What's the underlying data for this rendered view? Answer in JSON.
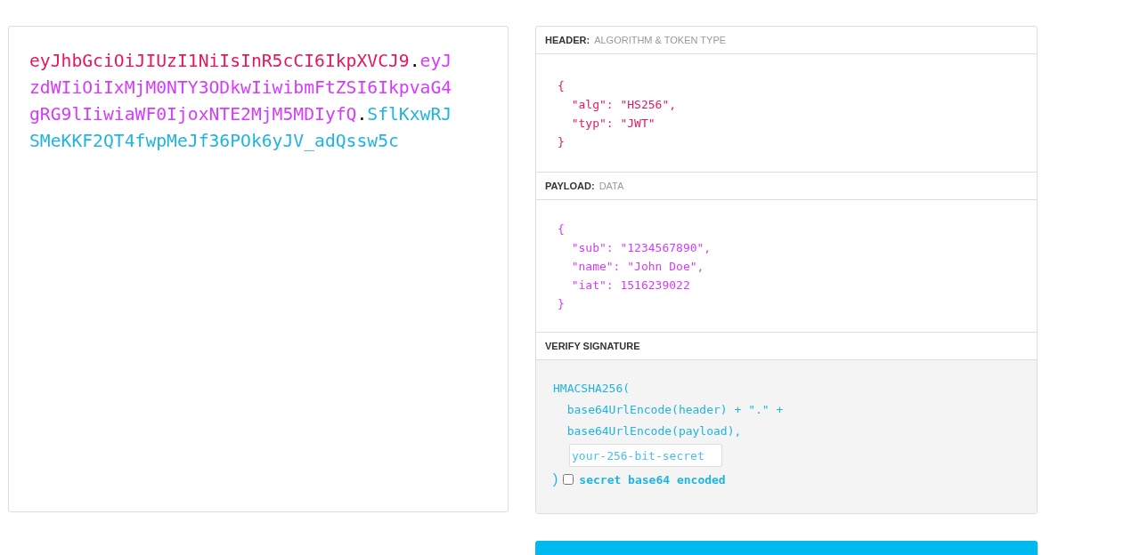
{
  "encoded": {
    "separator": ".",
    "parts": [
      {
        "text": "eyJhbGciOiJIUzI1NiIsInR5cCI6IkpXVCJ9",
        "color": "#e8175d"
      },
      {
        "text": "eyJzdWIiOiIxMjM0NTY3ODkwIiwibmFtZSI6IkpvaG4gRG9lIiwiaWF0IjoxNTE2MjM5MDIyfQ",
        "color": "#d63aff"
      },
      {
        "text": "SflKxwRJSMeKKF2QT4fwpMeJf36POk6yJV_adQssw5c",
        "color": "#1fb5e0"
      }
    ]
  },
  "sections": [
    {
      "kind": "header",
      "title": "HEADER:",
      "subtitle": "ALGORITHM & TOKEN TYPE",
      "lines": [
        "{",
        "  \"alg\": \"HS256\",",
        "  \"typ\": \"JWT\"",
        "}"
      ]
    },
    {
      "kind": "payload",
      "title": "PAYLOAD:",
      "subtitle": "DATA",
      "lines": [
        "{",
        "  \"sub\": \"1234567890\",",
        "  \"name\": \"John Doe\",",
        "  \"iat\": 1516239022",
        "}"
      ]
    },
    {
      "kind": "verify",
      "title": "VERIFY SIGNATURE",
      "lines": [
        "HMACSHA256(",
        "  base64UrlEncode(header) + \".\" +",
        "  base64UrlEncode(payload),"
      ],
      "secret": {
        "placeholder": "your-256-bit-secret"
      },
      "close": ")",
      "checkbox": {
        "label": "secret base64 encoded",
        "checked": false
      }
    }
  ]
}
